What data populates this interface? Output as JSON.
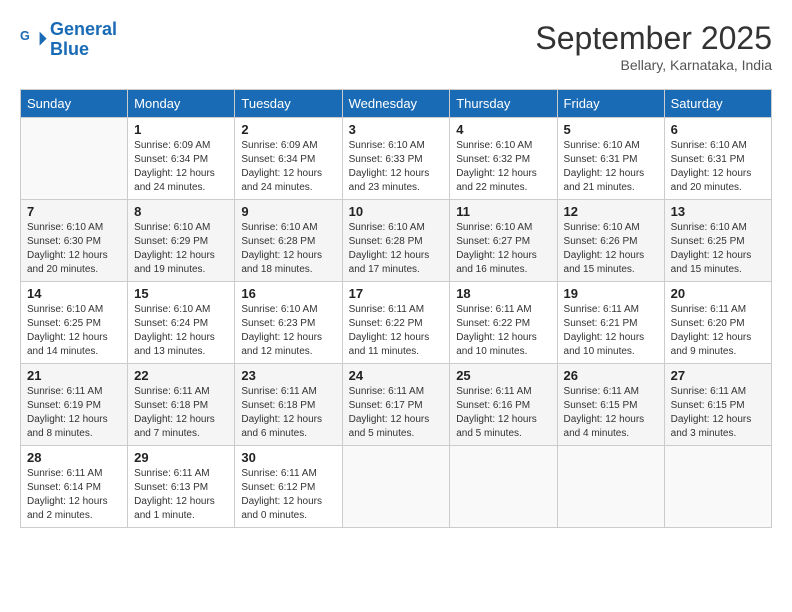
{
  "logo": {
    "line1": "General",
    "line2": "Blue"
  },
  "title": "September 2025",
  "subtitle": "Bellary, Karnataka, India",
  "weekdays": [
    "Sunday",
    "Monday",
    "Tuesday",
    "Wednesday",
    "Thursday",
    "Friday",
    "Saturday"
  ],
  "weeks": [
    [
      {
        "day": null
      },
      {
        "day": 1,
        "sunrise": "6:09 AM",
        "sunset": "6:34 PM",
        "daylight": "12 hours and 24 minutes."
      },
      {
        "day": 2,
        "sunrise": "6:09 AM",
        "sunset": "6:34 PM",
        "daylight": "12 hours and 24 minutes."
      },
      {
        "day": 3,
        "sunrise": "6:10 AM",
        "sunset": "6:33 PM",
        "daylight": "12 hours and 23 minutes."
      },
      {
        "day": 4,
        "sunrise": "6:10 AM",
        "sunset": "6:32 PM",
        "daylight": "12 hours and 22 minutes."
      },
      {
        "day": 5,
        "sunrise": "6:10 AM",
        "sunset": "6:31 PM",
        "daylight": "12 hours and 21 minutes."
      },
      {
        "day": 6,
        "sunrise": "6:10 AM",
        "sunset": "6:31 PM",
        "daylight": "12 hours and 20 minutes."
      }
    ],
    [
      {
        "day": 7,
        "sunrise": "6:10 AM",
        "sunset": "6:30 PM",
        "daylight": "12 hours and 20 minutes."
      },
      {
        "day": 8,
        "sunrise": "6:10 AM",
        "sunset": "6:29 PM",
        "daylight": "12 hours and 19 minutes."
      },
      {
        "day": 9,
        "sunrise": "6:10 AM",
        "sunset": "6:28 PM",
        "daylight": "12 hours and 18 minutes."
      },
      {
        "day": 10,
        "sunrise": "6:10 AM",
        "sunset": "6:28 PM",
        "daylight": "12 hours and 17 minutes."
      },
      {
        "day": 11,
        "sunrise": "6:10 AM",
        "sunset": "6:27 PM",
        "daylight": "12 hours and 16 minutes."
      },
      {
        "day": 12,
        "sunrise": "6:10 AM",
        "sunset": "6:26 PM",
        "daylight": "12 hours and 15 minutes."
      },
      {
        "day": 13,
        "sunrise": "6:10 AM",
        "sunset": "6:25 PM",
        "daylight": "12 hours and 15 minutes."
      }
    ],
    [
      {
        "day": 14,
        "sunrise": "6:10 AM",
        "sunset": "6:25 PM",
        "daylight": "12 hours and 14 minutes."
      },
      {
        "day": 15,
        "sunrise": "6:10 AM",
        "sunset": "6:24 PM",
        "daylight": "12 hours and 13 minutes."
      },
      {
        "day": 16,
        "sunrise": "6:10 AM",
        "sunset": "6:23 PM",
        "daylight": "12 hours and 12 minutes."
      },
      {
        "day": 17,
        "sunrise": "6:11 AM",
        "sunset": "6:22 PM",
        "daylight": "12 hours and 11 minutes."
      },
      {
        "day": 18,
        "sunrise": "6:11 AM",
        "sunset": "6:22 PM",
        "daylight": "12 hours and 10 minutes."
      },
      {
        "day": 19,
        "sunrise": "6:11 AM",
        "sunset": "6:21 PM",
        "daylight": "12 hours and 10 minutes."
      },
      {
        "day": 20,
        "sunrise": "6:11 AM",
        "sunset": "6:20 PM",
        "daylight": "12 hours and 9 minutes."
      }
    ],
    [
      {
        "day": 21,
        "sunrise": "6:11 AM",
        "sunset": "6:19 PM",
        "daylight": "12 hours and 8 minutes."
      },
      {
        "day": 22,
        "sunrise": "6:11 AM",
        "sunset": "6:18 PM",
        "daylight": "12 hours and 7 minutes."
      },
      {
        "day": 23,
        "sunrise": "6:11 AM",
        "sunset": "6:18 PM",
        "daylight": "12 hours and 6 minutes."
      },
      {
        "day": 24,
        "sunrise": "6:11 AM",
        "sunset": "6:17 PM",
        "daylight": "12 hours and 5 minutes."
      },
      {
        "day": 25,
        "sunrise": "6:11 AM",
        "sunset": "6:16 PM",
        "daylight": "12 hours and 5 minutes."
      },
      {
        "day": 26,
        "sunrise": "6:11 AM",
        "sunset": "6:15 PM",
        "daylight": "12 hours and 4 minutes."
      },
      {
        "day": 27,
        "sunrise": "6:11 AM",
        "sunset": "6:15 PM",
        "daylight": "12 hours and 3 minutes."
      }
    ],
    [
      {
        "day": 28,
        "sunrise": "6:11 AM",
        "sunset": "6:14 PM",
        "daylight": "12 hours and 2 minutes."
      },
      {
        "day": 29,
        "sunrise": "6:11 AM",
        "sunset": "6:13 PM",
        "daylight": "12 hours and 1 minute."
      },
      {
        "day": 30,
        "sunrise": "6:11 AM",
        "sunset": "6:12 PM",
        "daylight": "12 hours and 0 minutes."
      },
      {
        "day": null
      },
      {
        "day": null
      },
      {
        "day": null
      },
      {
        "day": null
      }
    ]
  ]
}
